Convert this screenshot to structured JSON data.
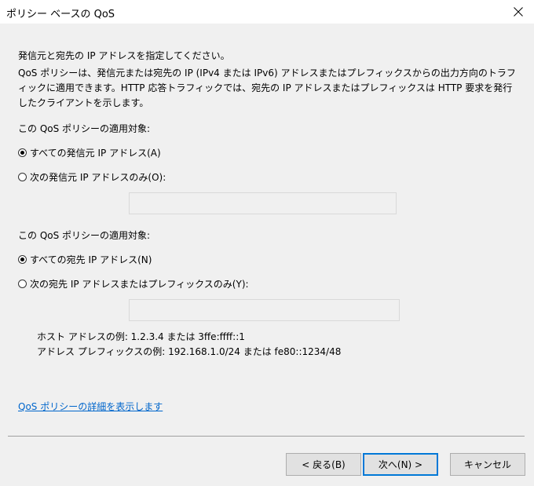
{
  "window": {
    "title": "ポリシー ベースの QoS",
    "close_icon": "close-icon"
  },
  "intro": {
    "heading": "発信元と宛先の IP アドレスを指定してください。",
    "description": "QoS ポリシーは、発信元または宛先の IP (IPv4 または IPv6) アドレスまたはプレフィックスからの出力方向のトラフィックに適用できます。HTTP 応答トラフィックでは、宛先の IP アドレスまたはプレフィックスは HTTP 要求を発行したクライアントを示します。"
  },
  "source": {
    "label": "この QoS ポリシーの適用対象:",
    "option_all": "すべての発信元 IP アドレス(A)",
    "option_only": "次の発信元 IP アドレスのみ(O):",
    "selected": "all",
    "input_value": ""
  },
  "destination": {
    "label": "この QoS ポリシーの適用対象:",
    "option_all": "すべての宛先 IP アドレス(N)",
    "option_only": "次の宛先 IP アドレスまたはプレフィックスのみ(Y):",
    "selected": "all",
    "input_value": ""
  },
  "examples": {
    "host": "ホスト アドレスの例: 1.2.3.4 または 3ffe:ffff::1",
    "prefix": "アドレス プレフィックスの例: 192.168.1.0/24 または fe80::1234/48"
  },
  "link": {
    "details": "QoS ポリシーの詳細を表示します"
  },
  "buttons": {
    "back": "< 戻る(B)",
    "next": "次へ(N) >",
    "cancel": "キャンセル"
  },
  "colors": {
    "link": "#0066cc",
    "default_button_border": "#0078d7",
    "background": "#f0f0f0"
  }
}
